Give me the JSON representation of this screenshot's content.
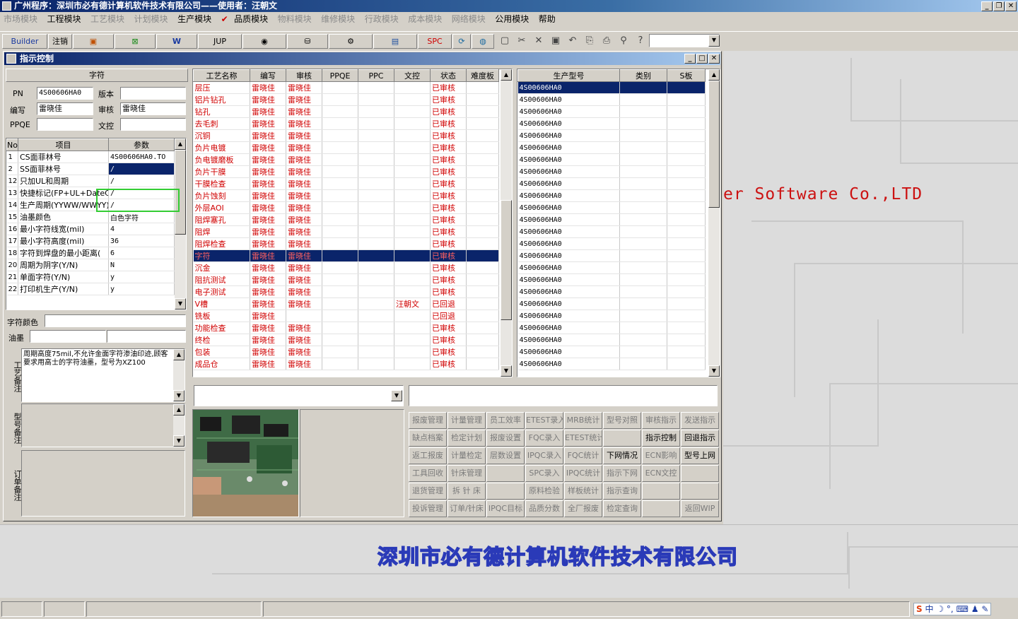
{
  "app_title": "广州程序：深圳市必有德计算机软件技术有限公司——使用者：汪朝文",
  "menu": [
    {
      "label": "市场模块",
      "enabled": false
    },
    {
      "label": "工程模块",
      "enabled": true
    },
    {
      "label": "工艺模块",
      "enabled": false
    },
    {
      "label": "计划模块",
      "enabled": false
    },
    {
      "label": "生产模块",
      "enabled": true
    },
    {
      "label": "品质模块",
      "enabled": true,
      "checked": true
    },
    {
      "label": "物料模块",
      "enabled": false
    },
    {
      "label": "维修模块",
      "enabled": false
    },
    {
      "label": "行政模块",
      "enabled": false
    },
    {
      "label": "成本模块",
      "enabled": false
    },
    {
      "label": "网络模块",
      "enabled": false
    },
    {
      "label": "公用模块",
      "enabled": true
    },
    {
      "label": "帮助",
      "enabled": true
    }
  ],
  "toolbar": {
    "builder": "Builder",
    "logout": "注销",
    "jup": "JUP",
    "spc": "SPC"
  },
  "window_title": "指示控制",
  "left": {
    "header": "字符",
    "pn_label": "PN",
    "pn_value": "4S00606HA0",
    "version_label": "版本",
    "version_value": "",
    "editor_label": "编写",
    "editor_value": "雷晓佳",
    "reviewer_label": "审核",
    "reviewer_value": "雷晓佳",
    "ppqe_label": "PPQE",
    "ppqe_value": "",
    "doc_label": "文控",
    "doc_value": "",
    "param_headers": [
      "No",
      "项目",
      "参数"
    ],
    "params": [
      [
        "1",
        "CS面菲林号",
        "4S00606HA0.TO"
      ],
      [
        "2",
        "SS面菲林号",
        "/"
      ],
      [
        "12",
        "只加UL和周期",
        "/"
      ],
      [
        "13",
        "快捷标记(FP+UL+DateCo",
        "/"
      ],
      [
        "14",
        "生产周期(YYWW/WWYY)",
        "/"
      ],
      [
        "15",
        "油墨颜色",
        "白色字符"
      ],
      [
        "16",
        "最小字符线宽(mil)",
        "4"
      ],
      [
        "17",
        "最小字符高度(mil)",
        "36"
      ],
      [
        "18",
        "字符到焊盘的最小距离(",
        "6"
      ],
      [
        "20",
        "周期为阴字(Y/N)",
        "N"
      ],
      [
        "21",
        "单面字符(Y/N)",
        "y"
      ],
      [
        "22",
        "打印机生产(Y/N)",
        "y"
      ]
    ],
    "char_color_label": "字符颜色",
    "char_color_value": "",
    "ink_label": "油墨",
    "ink_value": "",
    "process_note_label": "工艺备注",
    "process_note": "周期高度75mil,不允许金面字符渗油印迹,顾客要求用高士的字符油墨，型号为XZ100",
    "model_note_label": "型号备注",
    "order_note_label": "订单备注"
  },
  "process": {
    "headers": [
      "工艺名称",
      "编写",
      "审核",
      "PPQE",
      "PPC",
      "文控",
      "状态",
      "难度板"
    ],
    "rows": [
      [
        "层压",
        "雷晓佳",
        "雷晓佳",
        "",
        "",
        "",
        "已审核",
        ""
      ],
      [
        "铝片钻孔",
        "雷晓佳",
        "雷晓佳",
        "",
        "",
        "",
        "已审核",
        ""
      ],
      [
        "钻孔",
        "雷晓佳",
        "雷晓佳",
        "",
        "",
        "",
        "已审核",
        ""
      ],
      [
        "去毛刺",
        "雷晓佳",
        "雷晓佳",
        "",
        "",
        "",
        "已审核",
        ""
      ],
      [
        "沉铜",
        "雷晓佳",
        "雷晓佳",
        "",
        "",
        "",
        "已审核",
        ""
      ],
      [
        "负片电镀",
        "雷晓佳",
        "雷晓佳",
        "",
        "",
        "",
        "已审核",
        ""
      ],
      [
        "负电镀磨板",
        "雷晓佳",
        "雷晓佳",
        "",
        "",
        "",
        "已审核",
        ""
      ],
      [
        "负片干膜",
        "雷晓佳",
        "雷晓佳",
        "",
        "",
        "",
        "已审核",
        ""
      ],
      [
        "干膜检查",
        "雷晓佳",
        "雷晓佳",
        "",
        "",
        "",
        "已审核",
        ""
      ],
      [
        "负片蚀刻",
        "雷晓佳",
        "雷晓佳",
        "",
        "",
        "",
        "已审核",
        ""
      ],
      [
        "外层AOI",
        "雷晓佳",
        "雷晓佳",
        "",
        "",
        "",
        "已审核",
        ""
      ],
      [
        "阻焊塞孔",
        "雷晓佳",
        "雷晓佳",
        "",
        "",
        "",
        "已审核",
        ""
      ],
      [
        "阻焊",
        "雷晓佳",
        "雷晓佳",
        "",
        "",
        "",
        "已审核",
        ""
      ],
      [
        "阻焊检查",
        "雷晓佳",
        "雷晓佳",
        "",
        "",
        "",
        "已审核",
        ""
      ],
      [
        "字符",
        "雷晓佳",
        "雷晓佳",
        "",
        "",
        "",
        "已审核",
        ""
      ],
      [
        "沉金",
        "雷晓佳",
        "雷晓佳",
        "",
        "",
        "",
        "已审核",
        ""
      ],
      [
        "阻抗测试",
        "雷晓佳",
        "雷晓佳",
        "",
        "",
        "",
        "已审核",
        ""
      ],
      [
        "电子测试",
        "雷晓佳",
        "雷晓佳",
        "",
        "",
        "",
        "已审核",
        ""
      ],
      [
        "V槽",
        "雷晓佳",
        "雷晓佳",
        "",
        "",
        "汪朝文",
        "已回退",
        ""
      ],
      [
        "铣板",
        "雷晓佳",
        "",
        "",
        "",
        "",
        "已回退",
        ""
      ],
      [
        "功能检查",
        "雷晓佳",
        "雷晓佳",
        "",
        "",
        "",
        "已审核",
        ""
      ],
      [
        "终检",
        "雷晓佳",
        "雷晓佳",
        "",
        "",
        "",
        "已审核",
        ""
      ],
      [
        "包装",
        "雷晓佳",
        "雷晓佳",
        "",
        "",
        "",
        "已审核",
        ""
      ],
      [
        "成品仓",
        "雷晓佳",
        "雷晓佳",
        "",
        "",
        "",
        "已审核",
        ""
      ]
    ],
    "selected_index": 14
  },
  "models": {
    "headers": [
      "生产型号",
      "类别",
      "S板"
    ],
    "value": "4S00606HA0",
    "count": 24
  },
  "buttons": [
    [
      {
        "label": "报废管理",
        "enabled": false
      },
      {
        "label": "计量管理",
        "enabled": false
      },
      {
        "label": "员工效率",
        "enabled": false
      },
      {
        "label": "ETEST录入",
        "enabled": false
      },
      {
        "label": "MRB统计",
        "enabled": false
      },
      {
        "label": "型号对照",
        "enabled": false
      },
      {
        "label": "审核指示",
        "enabled": false
      },
      {
        "label": "发送指示",
        "enabled": false
      }
    ],
    [
      {
        "label": "缺点档案",
        "enabled": false
      },
      {
        "label": "检定计划",
        "enabled": false
      },
      {
        "label": "报废设置",
        "enabled": false
      },
      {
        "label": "FQC录入",
        "enabled": false
      },
      {
        "label": "ETEST统计",
        "enabled": false
      },
      {
        "label": "",
        "enabled": false
      },
      {
        "label": "指示控制",
        "enabled": true
      },
      {
        "label": "回退指示",
        "enabled": true
      }
    ],
    [
      {
        "label": "返工报废",
        "enabled": false
      },
      {
        "label": "计量检定",
        "enabled": false
      },
      {
        "label": "层数设置",
        "enabled": false
      },
      {
        "label": "IPQC录入",
        "enabled": false
      },
      {
        "label": "FQC统计",
        "enabled": false
      },
      {
        "label": "下网情况",
        "enabled": true
      },
      {
        "label": "ECN影响",
        "enabled": false
      },
      {
        "label": "型号上网",
        "enabled": true
      }
    ],
    [
      {
        "label": "工具回收",
        "enabled": false
      },
      {
        "label": "针床管理",
        "enabled": false
      },
      {
        "label": "",
        "enabled": false
      },
      {
        "label": "SPC录入",
        "enabled": false
      },
      {
        "label": "IPQC统计",
        "enabled": false
      },
      {
        "label": "指示下网",
        "enabled": false
      },
      {
        "label": "ECN文控",
        "enabled": false
      },
      {
        "label": "",
        "enabled": false
      }
    ],
    [
      {
        "label": "退货管理",
        "enabled": false
      },
      {
        "label": "拆 针 床",
        "enabled": false
      },
      {
        "label": "",
        "enabled": false
      },
      {
        "label": "原料检验",
        "enabled": false
      },
      {
        "label": "样板统计",
        "enabled": false
      },
      {
        "label": "指示查询",
        "enabled": false
      },
      {
        "label": "",
        "enabled": false
      },
      {
        "label": "",
        "enabled": false
      }
    ],
    [
      {
        "label": "投诉管理",
        "enabled": false
      },
      {
        "label": "订单/针床",
        "enabled": false
      },
      {
        "label": "IPQC目标",
        "enabled": false
      },
      {
        "label": "品质分数",
        "enabled": false
      },
      {
        "label": "全厂报废",
        "enabled": false
      },
      {
        "label": "检定查询",
        "enabled": false
      },
      {
        "label": "",
        "enabled": false
      },
      {
        "label": "返回WIP",
        "enabled": false
      }
    ]
  ],
  "watermark": "er Software Co.,LTD",
  "company_banner": "深圳市必有德计算机软件技术有限公司",
  "tray": {
    "ime": "中"
  },
  "colors": {
    "title_bar": "#0a246a",
    "status_red": "#d00000",
    "selection": "#0a246a",
    "highlight_box": "#33cc33"
  }
}
